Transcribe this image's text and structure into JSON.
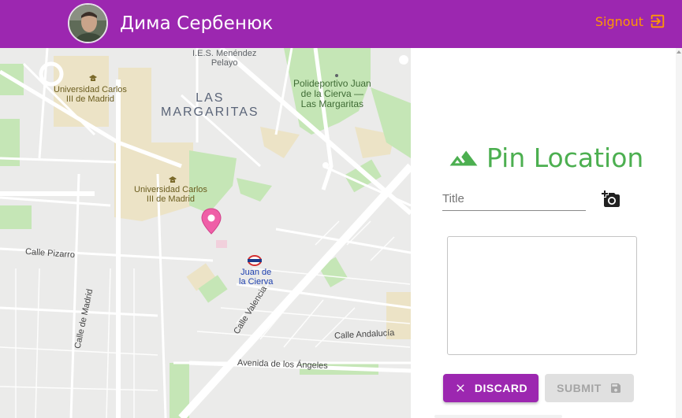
{
  "header": {
    "user_name": "Дима Сербенюк",
    "signout_label": "Signout",
    "signout_icon": "exit-to-app-icon",
    "avatar_icon": "user-avatar"
  },
  "map": {
    "labels": {
      "ies": "I.E.S. Menéndez\nPelayo",
      "uc3m_top": "Universidad Carlos\nIII de Madrid",
      "las_margaritas": "LAS\nMARGARITAS",
      "polideportivo": "Polideportivo Juan\nde la Cierva —\nLas Margaritas",
      "uc3m_mid": "Universidad Carlos\nIII de Madrid",
      "calle_pizarro": "Calle Pizarro",
      "juan_de_la_cierva": "Juan de\nla Cierva",
      "calle_de_madrid": "Calle de Madrid",
      "calle_valencia": "Calle Valencia",
      "calle_andalucia": "Calle Andalucía",
      "avenida_angeles": "Avenida de los Ángeles"
    },
    "pin_color": "#ef5fa7",
    "park_color": "#c5e6b6",
    "campus_color": "#ece3c6"
  },
  "panel": {
    "title": "Pin Location",
    "title_icon": "terrain-icon",
    "title_placeholder": "Title",
    "add_photo_icon": "add-a-photo-icon",
    "description_value": "",
    "discard_label": "DISCARD",
    "discard_icon": "close-icon",
    "submit_label": "SUBMIT",
    "submit_icon": "save-icon"
  },
  "colors": {
    "header": "#9c27b0",
    "accent": "#ff9800",
    "title_green": "#4caf50"
  }
}
